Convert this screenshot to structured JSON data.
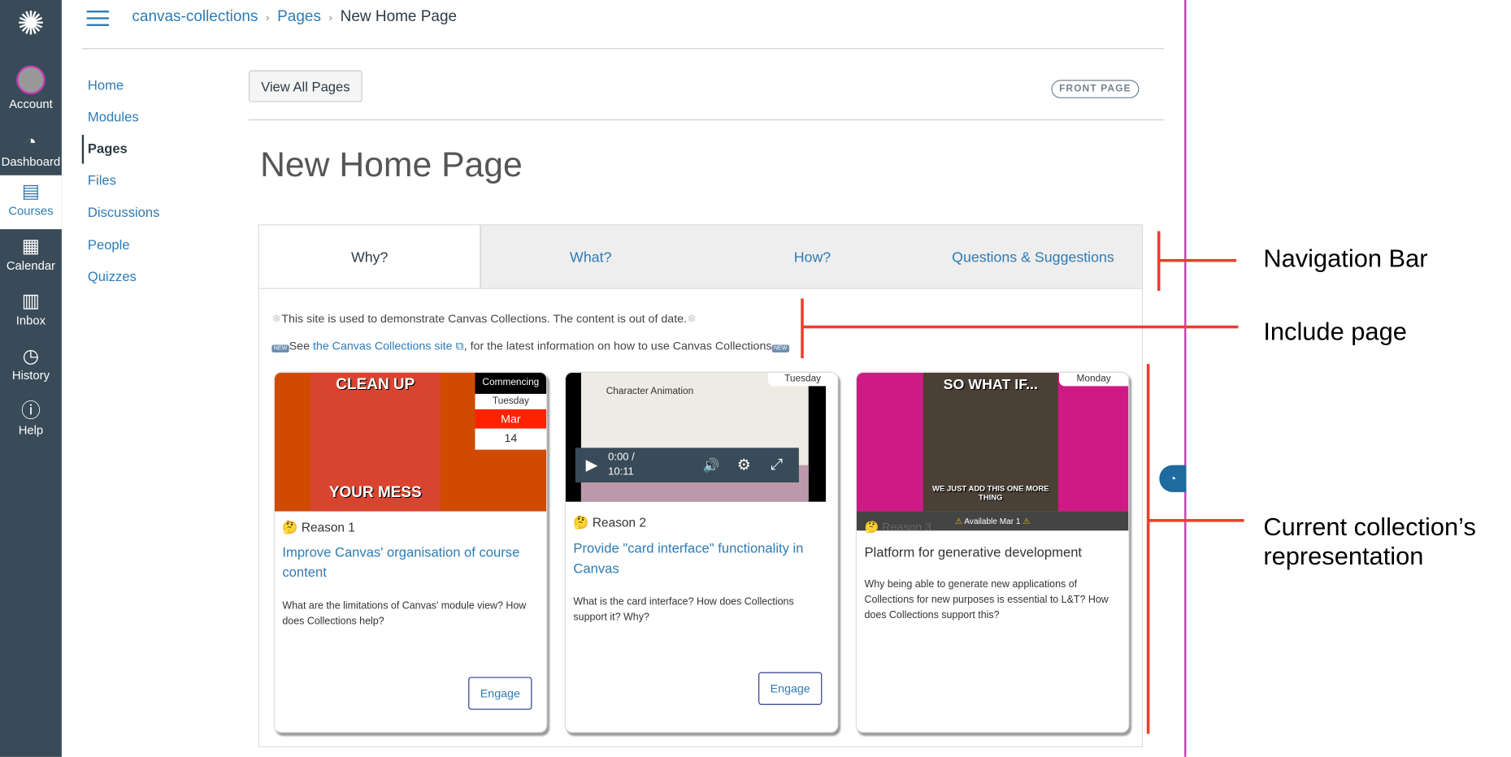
{
  "global_nav": [
    {
      "label": "Account",
      "icon": "avatar"
    },
    {
      "label": "Dashboard",
      "icon": "dashboard-icon"
    },
    {
      "label": "Courses",
      "icon": "courses-icon",
      "active": true
    },
    {
      "label": "Calendar",
      "icon": "calendar-icon"
    },
    {
      "label": "Inbox",
      "icon": "inbox-icon"
    },
    {
      "label": "History",
      "icon": "history-icon"
    },
    {
      "label": "Help",
      "icon": "help-icon"
    }
  ],
  "breadcrumb": {
    "course": "canvas-collections",
    "section": "Pages",
    "current": "New Home Page"
  },
  "course_nav": [
    "Home",
    "Modules",
    "Pages",
    "Files",
    "Discussions",
    "People",
    "Quizzes"
  ],
  "view_all_pages": "View All Pages",
  "front_page_badge": "FRONT PAGE",
  "page_title": "New Home Page",
  "tabs": [
    "Why?",
    "What?",
    "How?",
    "Questions & Suggestions"
  ],
  "notes": {
    "line1": "This site is used to demonstrate Canvas Collections. The content is out of date.",
    "line2_pre": "See ",
    "line2_link": "the Canvas Collections site",
    "line2_post": ", for the latest information on how to use Canvas Collections"
  },
  "cards": [
    {
      "label": "Reason 1",
      "title": "Improve Canvas' organisation of course content",
      "desc": "What are the  limitations of Canvas' module view? How does Collections help?",
      "button": "Engage",
      "date": {
        "head": "Commencing",
        "day": "Tuesday",
        "month": "Mar",
        "num": "14"
      },
      "meme_top": "CLEAN UP",
      "meme_bottom": "YOUR MESS"
    },
    {
      "label": "Reason 2",
      "title": "Provide \"card interface\" functionality in Canvas",
      "desc": "What is the card interface? How does Collections support it? Why?",
      "button": "Engage",
      "date": {
        "day": "Tuesday"
      },
      "video": {
        "slide_title": "Character Animation",
        "time": "0:00 /",
        "duration": "10:11"
      }
    },
    {
      "label": "Reason 3",
      "title": "Platform for generative development",
      "desc": "Why being able to generate new applications of Collections for new purposes is essential to L&T? How does Collections support this?",
      "date": {
        "day": "Monday"
      },
      "available": "Available Mar 1",
      "meme_top": "SO WHAT IF...",
      "meme_bottom": "WE JUST ADD THIS ONE MORE THING"
    }
  ],
  "annotations": [
    "Navigation Bar",
    "Include page",
    "Current collection’s",
    "representation"
  ],
  "colors": {
    "nav_bg": "#394B58",
    "link": "#2D7BB6",
    "annotation": "#E8412B",
    "divider": "#C13FB3"
  }
}
